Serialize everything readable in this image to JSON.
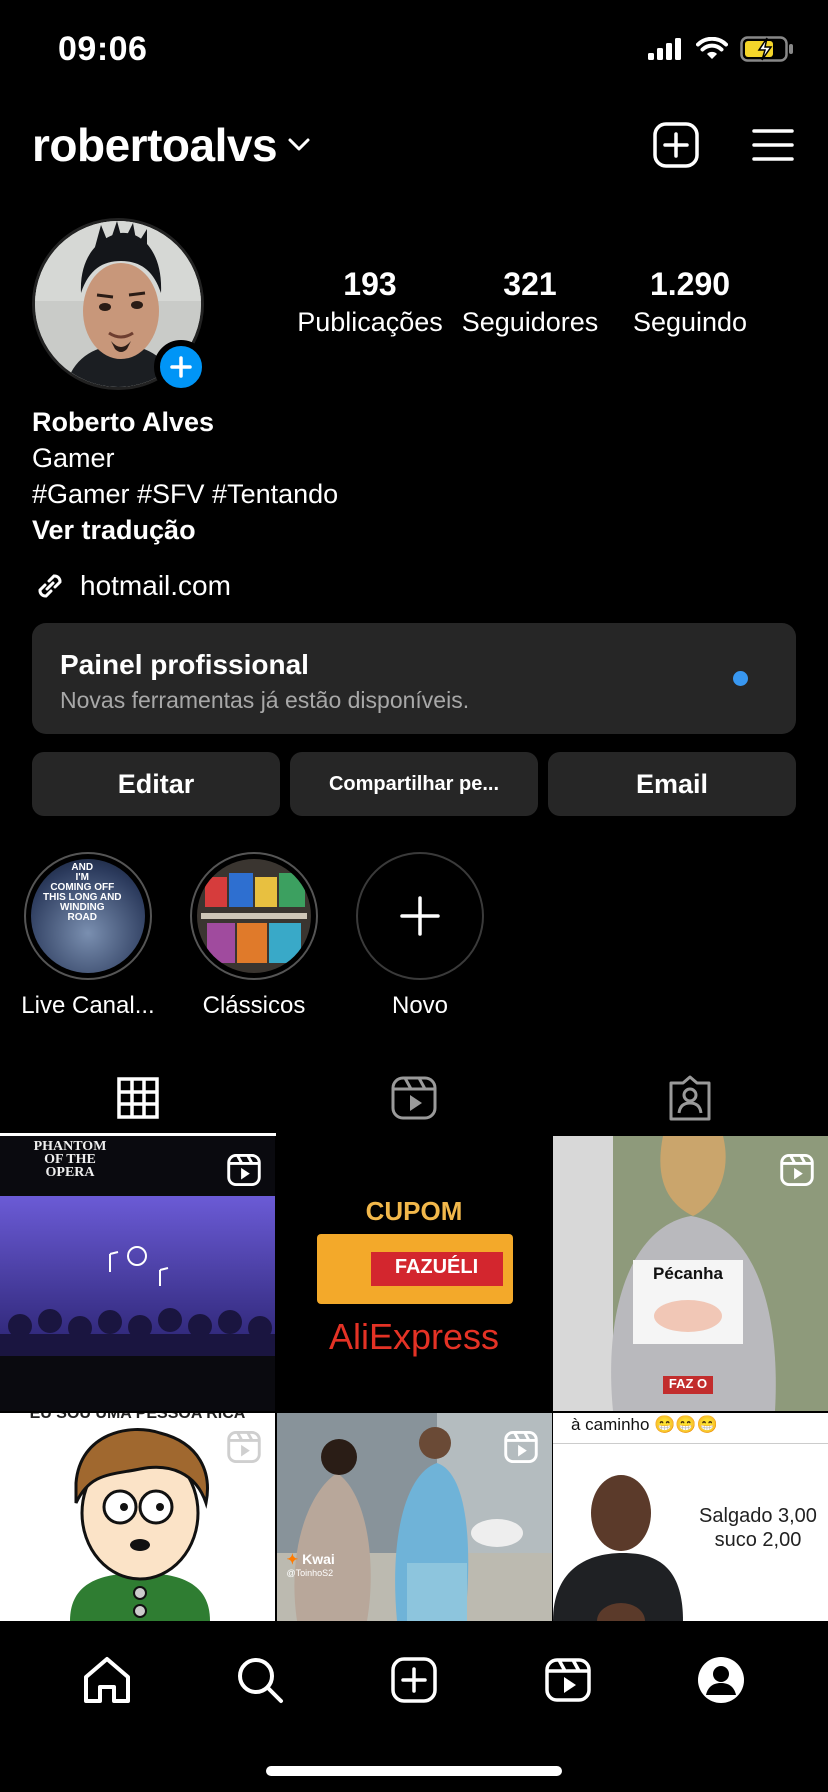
{
  "status": {
    "time": "09:06"
  },
  "header": {
    "username": "robertoalvs"
  },
  "profile": {
    "stats": [
      {
        "value": "193",
        "label": "Publicações"
      },
      {
        "value": "321",
        "label": "Seguidores"
      },
      {
        "value": "1.290",
        "label": "Seguindo"
      }
    ],
    "name": "Roberto Alves",
    "category": "Gamer",
    "hashtags": "#Gamer #SFV #Tentando",
    "translate": "Ver tradução",
    "link": "hotmail.com"
  },
  "pro_panel": {
    "title": "Painel profissional",
    "subtitle": "Novas ferramentas já estão disponíveis."
  },
  "actions": {
    "edit": "Editar",
    "share": "Compartilhar pe...",
    "email": "Email"
  },
  "highlights": [
    {
      "label": "Live Canal...",
      "text": "AND\nI'M\nCOMING OFF\nTHIS LONG AND\nWINDING\nROAD"
    },
    {
      "label": "Clássicos"
    },
    {
      "label": "Novo"
    }
  ],
  "grid": {
    "post1_caption": "PHANTOM\nOF THE\nOPERA",
    "post2_caption_top": "CUPOM",
    "post2_ticket": "FAZUÉLI",
    "post2_brand": "AliExpress",
    "post3_sign": "Pécanha",
    "post3_brand": "FAZ O",
    "post4_caption": "EU SOU UMA PESSOA RICA",
    "post5_watermark": "Kwai",
    "post5_handle": "@ToinhoS2",
    "post6_caption": "à caminho 😁😁😁",
    "post6_price1": "Salgado 3,00",
    "post6_price2": "suco 2,00"
  },
  "colors": {
    "accent": "#0095f6",
    "surface": "#262626",
    "background": "#000000"
  }
}
